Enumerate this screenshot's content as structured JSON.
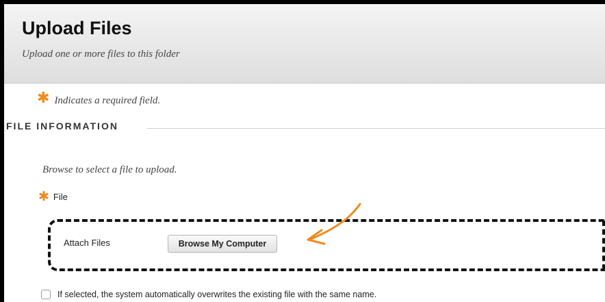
{
  "header": {
    "title": "Upload Files",
    "subtitle": "Upload one or more files to this folder"
  },
  "required_note": {
    "star": "✱",
    "text": "Indicates a required field."
  },
  "section": {
    "heading": "FILE INFORMATION"
  },
  "form": {
    "hint": "Browse to select a file to upload.",
    "file_star": "✱",
    "file_label": "File",
    "attach_label": "Attach Files",
    "browse_button_label": "Browse My Computer",
    "overwrite_checked": false,
    "overwrite_text": "If selected, the system automatically overwrites the existing file with the same name."
  },
  "colors": {
    "accent_star": "#f08a1c",
    "annotation_arrow": "#f08a1c",
    "dashed_border": "#111111"
  }
}
